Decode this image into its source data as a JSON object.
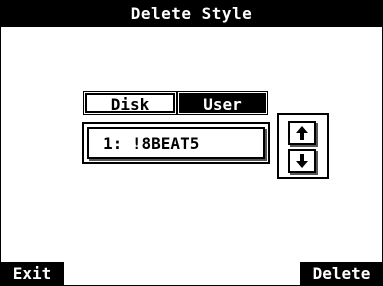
{
  "window": {
    "title": "Delete Style"
  },
  "tabs": {
    "disk_label": "Disk",
    "user_label": "User",
    "selected": "User"
  },
  "style_field": {
    "value": "1: !8BEAT5"
  },
  "scroll": {
    "up_icon": "arrow-up-icon",
    "down_icon": "arrow-down-icon"
  },
  "footer": {
    "exit_label": "Exit",
    "delete_label": "Delete"
  }
}
